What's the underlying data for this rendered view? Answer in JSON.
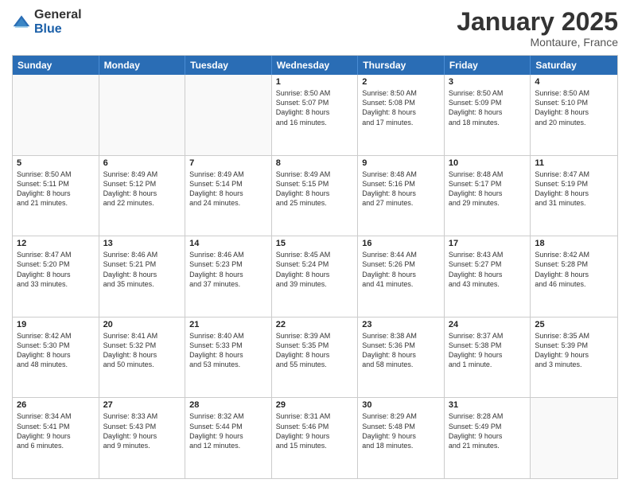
{
  "logo": {
    "general": "General",
    "blue": "Blue"
  },
  "title": "January 2025",
  "location": "Montaure, France",
  "header_days": [
    "Sunday",
    "Monday",
    "Tuesday",
    "Wednesday",
    "Thursday",
    "Friday",
    "Saturday"
  ],
  "weeks": [
    [
      {
        "day": "",
        "data": ""
      },
      {
        "day": "",
        "data": ""
      },
      {
        "day": "",
        "data": ""
      },
      {
        "day": "1",
        "data": "Sunrise: 8:50 AM\nSunset: 5:07 PM\nDaylight: 8 hours\nand 16 minutes."
      },
      {
        "day": "2",
        "data": "Sunrise: 8:50 AM\nSunset: 5:08 PM\nDaylight: 8 hours\nand 17 minutes."
      },
      {
        "day": "3",
        "data": "Sunrise: 8:50 AM\nSunset: 5:09 PM\nDaylight: 8 hours\nand 18 minutes."
      },
      {
        "day": "4",
        "data": "Sunrise: 8:50 AM\nSunset: 5:10 PM\nDaylight: 8 hours\nand 20 minutes."
      }
    ],
    [
      {
        "day": "5",
        "data": "Sunrise: 8:50 AM\nSunset: 5:11 PM\nDaylight: 8 hours\nand 21 minutes."
      },
      {
        "day": "6",
        "data": "Sunrise: 8:49 AM\nSunset: 5:12 PM\nDaylight: 8 hours\nand 22 minutes."
      },
      {
        "day": "7",
        "data": "Sunrise: 8:49 AM\nSunset: 5:14 PM\nDaylight: 8 hours\nand 24 minutes."
      },
      {
        "day": "8",
        "data": "Sunrise: 8:49 AM\nSunset: 5:15 PM\nDaylight: 8 hours\nand 25 minutes."
      },
      {
        "day": "9",
        "data": "Sunrise: 8:48 AM\nSunset: 5:16 PM\nDaylight: 8 hours\nand 27 minutes."
      },
      {
        "day": "10",
        "data": "Sunrise: 8:48 AM\nSunset: 5:17 PM\nDaylight: 8 hours\nand 29 minutes."
      },
      {
        "day": "11",
        "data": "Sunrise: 8:47 AM\nSunset: 5:19 PM\nDaylight: 8 hours\nand 31 minutes."
      }
    ],
    [
      {
        "day": "12",
        "data": "Sunrise: 8:47 AM\nSunset: 5:20 PM\nDaylight: 8 hours\nand 33 minutes."
      },
      {
        "day": "13",
        "data": "Sunrise: 8:46 AM\nSunset: 5:21 PM\nDaylight: 8 hours\nand 35 minutes."
      },
      {
        "day": "14",
        "data": "Sunrise: 8:46 AM\nSunset: 5:23 PM\nDaylight: 8 hours\nand 37 minutes."
      },
      {
        "day": "15",
        "data": "Sunrise: 8:45 AM\nSunset: 5:24 PM\nDaylight: 8 hours\nand 39 minutes."
      },
      {
        "day": "16",
        "data": "Sunrise: 8:44 AM\nSunset: 5:26 PM\nDaylight: 8 hours\nand 41 minutes."
      },
      {
        "day": "17",
        "data": "Sunrise: 8:43 AM\nSunset: 5:27 PM\nDaylight: 8 hours\nand 43 minutes."
      },
      {
        "day": "18",
        "data": "Sunrise: 8:42 AM\nSunset: 5:28 PM\nDaylight: 8 hours\nand 46 minutes."
      }
    ],
    [
      {
        "day": "19",
        "data": "Sunrise: 8:42 AM\nSunset: 5:30 PM\nDaylight: 8 hours\nand 48 minutes."
      },
      {
        "day": "20",
        "data": "Sunrise: 8:41 AM\nSunset: 5:32 PM\nDaylight: 8 hours\nand 50 minutes."
      },
      {
        "day": "21",
        "data": "Sunrise: 8:40 AM\nSunset: 5:33 PM\nDaylight: 8 hours\nand 53 minutes."
      },
      {
        "day": "22",
        "data": "Sunrise: 8:39 AM\nSunset: 5:35 PM\nDaylight: 8 hours\nand 55 minutes."
      },
      {
        "day": "23",
        "data": "Sunrise: 8:38 AM\nSunset: 5:36 PM\nDaylight: 8 hours\nand 58 minutes."
      },
      {
        "day": "24",
        "data": "Sunrise: 8:37 AM\nSunset: 5:38 PM\nDaylight: 9 hours\nand 1 minute."
      },
      {
        "day": "25",
        "data": "Sunrise: 8:35 AM\nSunset: 5:39 PM\nDaylight: 9 hours\nand 3 minutes."
      }
    ],
    [
      {
        "day": "26",
        "data": "Sunrise: 8:34 AM\nSunset: 5:41 PM\nDaylight: 9 hours\nand 6 minutes."
      },
      {
        "day": "27",
        "data": "Sunrise: 8:33 AM\nSunset: 5:43 PM\nDaylight: 9 hours\nand 9 minutes."
      },
      {
        "day": "28",
        "data": "Sunrise: 8:32 AM\nSunset: 5:44 PM\nDaylight: 9 hours\nand 12 minutes."
      },
      {
        "day": "29",
        "data": "Sunrise: 8:31 AM\nSunset: 5:46 PM\nDaylight: 9 hours\nand 15 minutes."
      },
      {
        "day": "30",
        "data": "Sunrise: 8:29 AM\nSunset: 5:48 PM\nDaylight: 9 hours\nand 18 minutes."
      },
      {
        "day": "31",
        "data": "Sunrise: 8:28 AM\nSunset: 5:49 PM\nDaylight: 9 hours\nand 21 minutes."
      },
      {
        "day": "",
        "data": ""
      }
    ]
  ]
}
